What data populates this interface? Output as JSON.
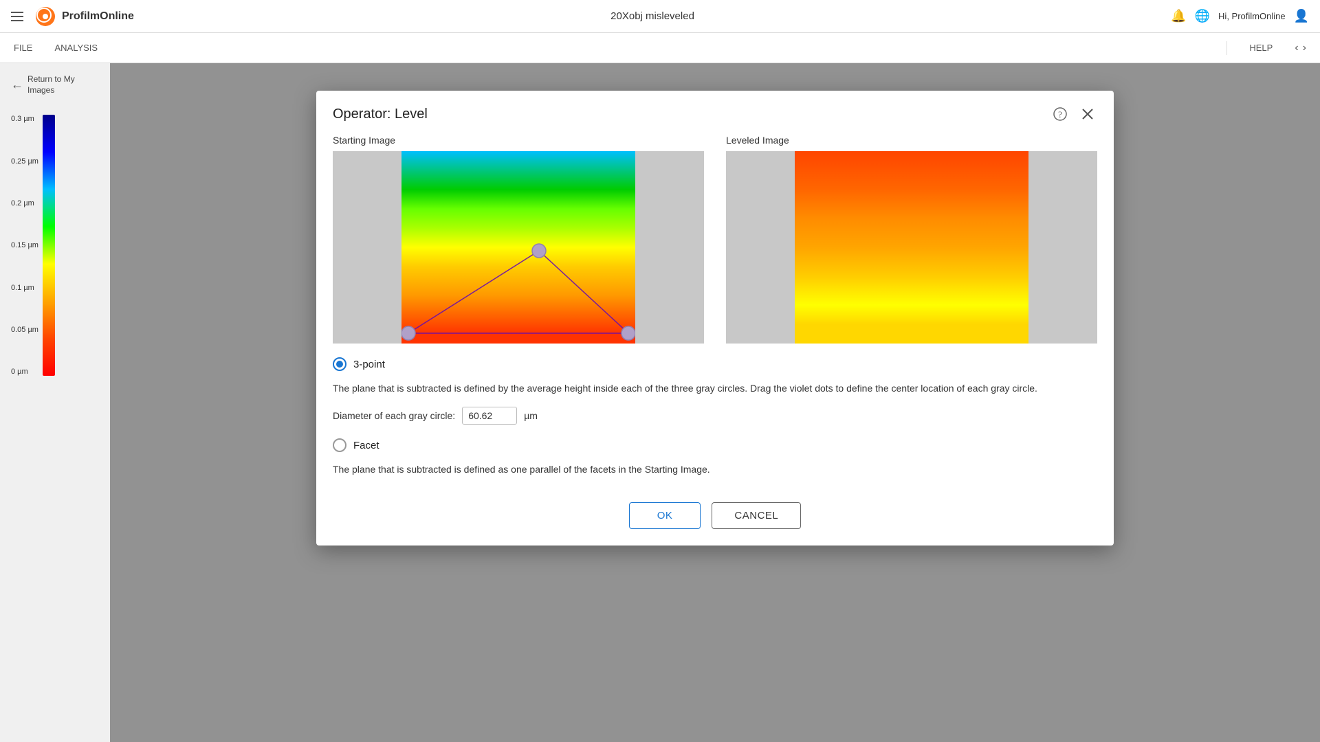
{
  "app": {
    "title": "20Xobj misleveled",
    "logo_text": "ProfilmOnline"
  },
  "nav": {
    "items": [
      "FILE",
      "ANALYSIS"
    ],
    "help": "HELP",
    "greeting": "Hi, ProfilmOnline"
  },
  "sidebar": {
    "back_label": "Return to My Images",
    "scale_labels": [
      "0.3 µm",
      "0.25 µm",
      "0.2 µm",
      "0.15 µm",
      "0.1 µm",
      "0.05 µm",
      "0 µm"
    ]
  },
  "dialog": {
    "title": "Operator: Level",
    "starting_image_label": "Starting Image",
    "leveled_image_label": "Leveled Image",
    "options": [
      {
        "id": "three-point",
        "label": "3-point",
        "selected": true,
        "description": "The plane that is subtracted is defined by the average height inside each of the three gray circles. Drag the violet dots to define the center location of each gray circle."
      },
      {
        "id": "facet",
        "label": "Facet",
        "selected": false,
        "description": "The plane that is subtracted is defined as one parallel of the facets in the Starting Image."
      }
    ],
    "diameter_label": "Diameter of each gray circle:",
    "diameter_value": "60.62",
    "diameter_unit": "µm",
    "ok_label": "OK",
    "cancel_label": "CANCEL"
  }
}
